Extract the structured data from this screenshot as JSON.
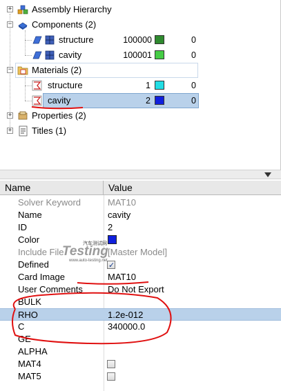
{
  "tree": {
    "assembly": "Assembly Hierarchy",
    "components": "Components (2)",
    "component_items": [
      {
        "label": "structure",
        "id": "100000",
        "count": "0",
        "color": "#2f8a2f"
      },
      {
        "label": "cavity",
        "id": "100001",
        "count": "0",
        "color": "#45cc45"
      }
    ],
    "materials": "Materials (2)",
    "material_items": [
      {
        "label": "structure",
        "id": "1",
        "count": "0",
        "color": "#22dde4"
      },
      {
        "label": "cavity",
        "id": "2",
        "count": "0",
        "color": "#1020dd"
      }
    ],
    "properties": "Properties (2)",
    "titles": "Titles (1)"
  },
  "colors": {
    "selected_row": "#b9d1ea",
    "annotation_red": "#e01010"
  },
  "props": {
    "header_name": "Name",
    "header_value": "Value",
    "rows": [
      {
        "name": "Solver Keyword",
        "value": "MAT10",
        "dim": true
      },
      {
        "name": "Name",
        "value": "cavity"
      },
      {
        "name": "ID",
        "value": "2"
      },
      {
        "name": "Color",
        "value": ""
      },
      {
        "name": "Include File",
        "value": "[Master Model]",
        "dim": true
      },
      {
        "name": "Defined",
        "value": ""
      },
      {
        "name": "Card Image",
        "value": "MAT10"
      },
      {
        "name": "User Comments",
        "value": "Do Not Export"
      },
      {
        "name": "BULK",
        "value": ""
      },
      {
        "name": "RHO",
        "value": "1.2e-012"
      },
      {
        "name": "C",
        "value": "340000.0"
      },
      {
        "name": "GE",
        "value": ""
      },
      {
        "name": "ALPHA",
        "value": ""
      },
      {
        "name": "MAT4",
        "value": ""
      },
      {
        "name": "MAT5",
        "value": ""
      }
    ]
  },
  "watermark": {
    "main": "Testing",
    "sub": "汽车测试网",
    "url": "www.auto-testing.net"
  }
}
